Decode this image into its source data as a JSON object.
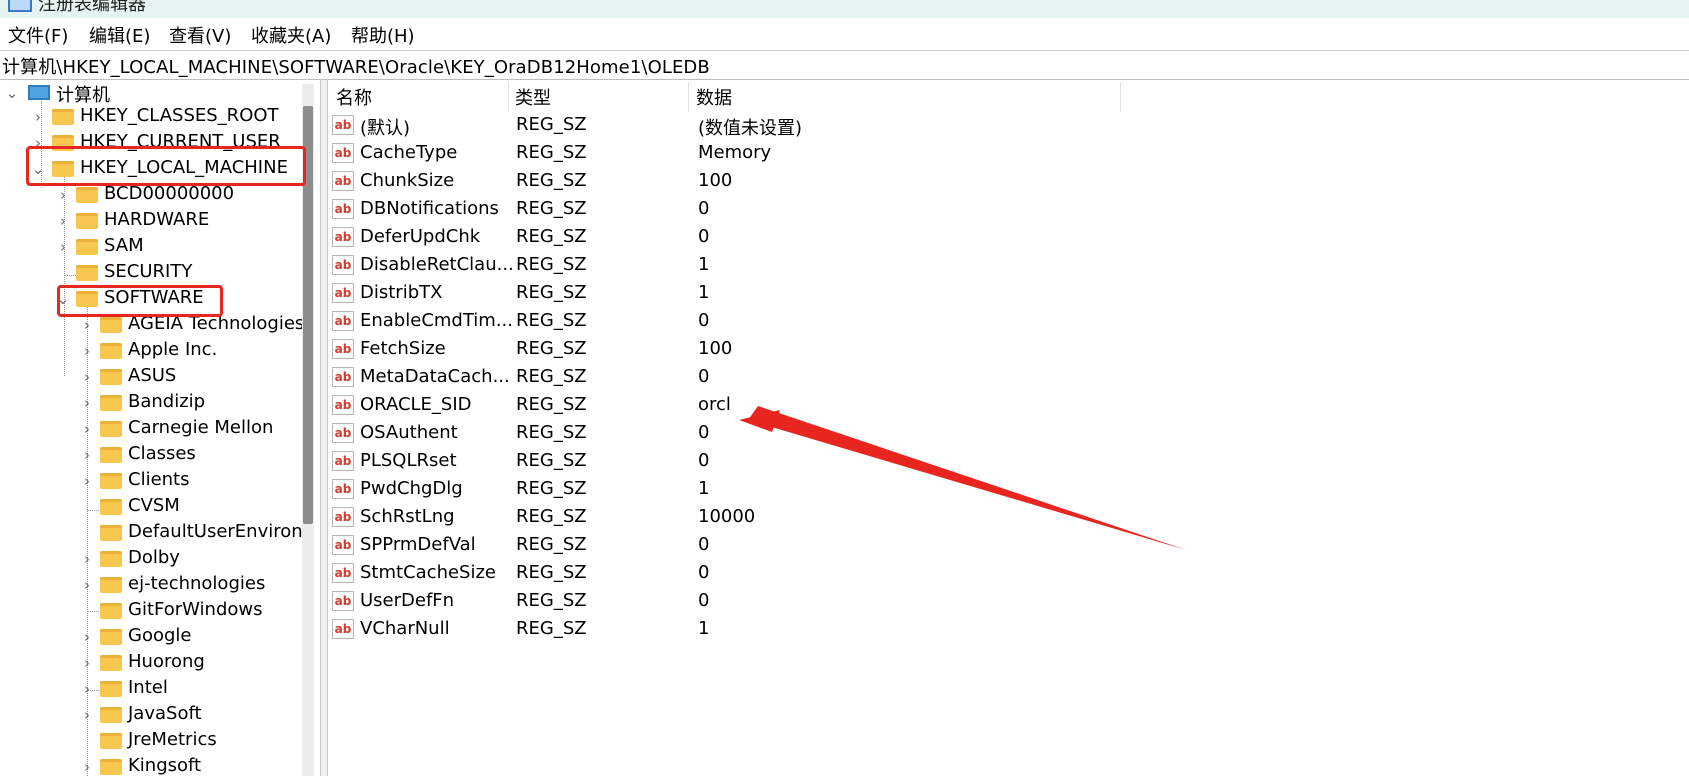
{
  "window": {
    "title": "注册表编辑器"
  },
  "menu": [
    "文件(F)",
    "编辑(E)",
    "查看(V)",
    "收藏夹(A)",
    "帮助(H)"
  ],
  "address": "计算机\\HKEY_LOCAL_MACHINE\\SOFTWARE\\Oracle\\KEY_OraDB12Home1\\OLEDB",
  "tree": {
    "root": "计算机",
    "hives": [
      "HKEY_CLASSES_ROOT",
      "HKEY_CURRENT_USER",
      "HKEY_LOCAL_MACHINE"
    ],
    "hklm_children": [
      "BCD00000000",
      "HARDWARE",
      "SAM",
      "SECURITY",
      "SOFTWARE"
    ],
    "software_children": [
      "AGEIA Technologies",
      "Apple Inc.",
      "ASUS",
      "Bandizip",
      "Carnegie Mellon",
      "Classes",
      "Clients",
      "CVSM",
      "DefaultUserEnviron",
      "Dolby",
      "ej-technologies",
      "GitForWindows",
      "Google",
      "Huorong",
      "Intel",
      "JavaSoft",
      "JreMetrics",
      "Kingsoft"
    ]
  },
  "columns": {
    "name": "名称",
    "type": "类型",
    "data": "数据"
  },
  "values": [
    {
      "name": "(默认)",
      "type": "REG_SZ",
      "data": "(数值未设置)"
    },
    {
      "name": "CacheType",
      "type": "REG_SZ",
      "data": "Memory"
    },
    {
      "name": "ChunkSize",
      "type": "REG_SZ",
      "data": "100"
    },
    {
      "name": "DBNotifications",
      "type": "REG_SZ",
      "data": "0"
    },
    {
      "name": "DeferUpdChk",
      "type": "REG_SZ",
      "data": "0"
    },
    {
      "name": "DisableRetClau...",
      "type": "REG_SZ",
      "data": "1"
    },
    {
      "name": "DistribTX",
      "type": "REG_SZ",
      "data": "1"
    },
    {
      "name": "EnableCmdTim...",
      "type": "REG_SZ",
      "data": "0"
    },
    {
      "name": "FetchSize",
      "type": "REG_SZ",
      "data": "100"
    },
    {
      "name": "MetaDataCach...",
      "type": "REG_SZ",
      "data": "0"
    },
    {
      "name": "ORACLE_SID",
      "type": "REG_SZ",
      "data": "orcl"
    },
    {
      "name": "OSAuthent",
      "type": "REG_SZ",
      "data": "0"
    },
    {
      "name": "PLSQLRset",
      "type": "REG_SZ",
      "data": "0"
    },
    {
      "name": "PwdChgDlg",
      "type": "REG_SZ",
      "data": "1"
    },
    {
      "name": "SchRstLng",
      "type": "REG_SZ",
      "data": "10000"
    },
    {
      "name": "SPPrmDefVal",
      "type": "REG_SZ",
      "data": "0"
    },
    {
      "name": "StmtCacheSize",
      "type": "REG_SZ",
      "data": "0"
    },
    {
      "name": "UserDefFn",
      "type": "REG_SZ",
      "data": "0"
    },
    {
      "name": "VCharNull",
      "type": "REG_SZ",
      "data": "1"
    }
  ],
  "colors": {
    "annotation": "#e8261f",
    "folder": "#f7c74f",
    "titlebar": "#e6f4f1"
  }
}
